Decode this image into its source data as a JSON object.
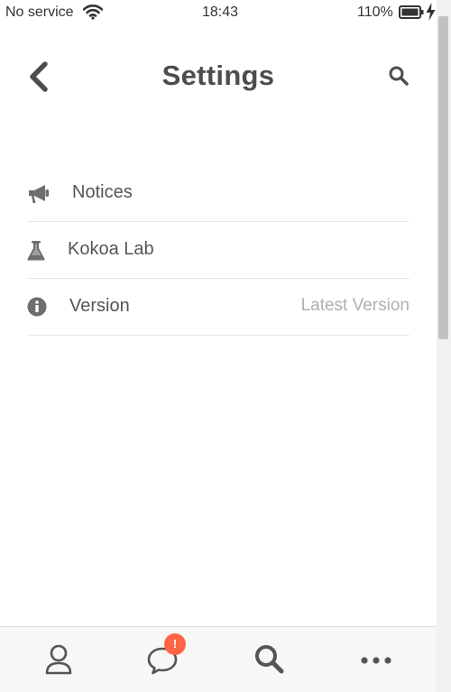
{
  "status_bar": {
    "carrier": "No service",
    "time": "18:43",
    "battery_percent": "110%"
  },
  "header": {
    "title": "Settings"
  },
  "settings": {
    "items": [
      {
        "label": "Notices",
        "icon": "megaphone-icon"
      },
      {
        "label": "Kokoa Lab",
        "icon": "flask-icon"
      },
      {
        "label": "Version",
        "icon": "info-icon",
        "value": "Latest Version"
      }
    ]
  },
  "tab_bar": {
    "tabs": [
      {
        "name": "profile",
        "icon": "person-icon"
      },
      {
        "name": "chats",
        "icon": "chat-bubble-icon",
        "badge": "!"
      },
      {
        "name": "search",
        "icon": "search-icon"
      },
      {
        "name": "more",
        "icon": "more-icon"
      }
    ]
  },
  "colors": {
    "text": "#4d4d4d",
    "icon": "#6e6e6e",
    "value_text": "#b0b0b0",
    "badge": "#ff6446",
    "tab_bar_bg": "#f7f7f5"
  }
}
